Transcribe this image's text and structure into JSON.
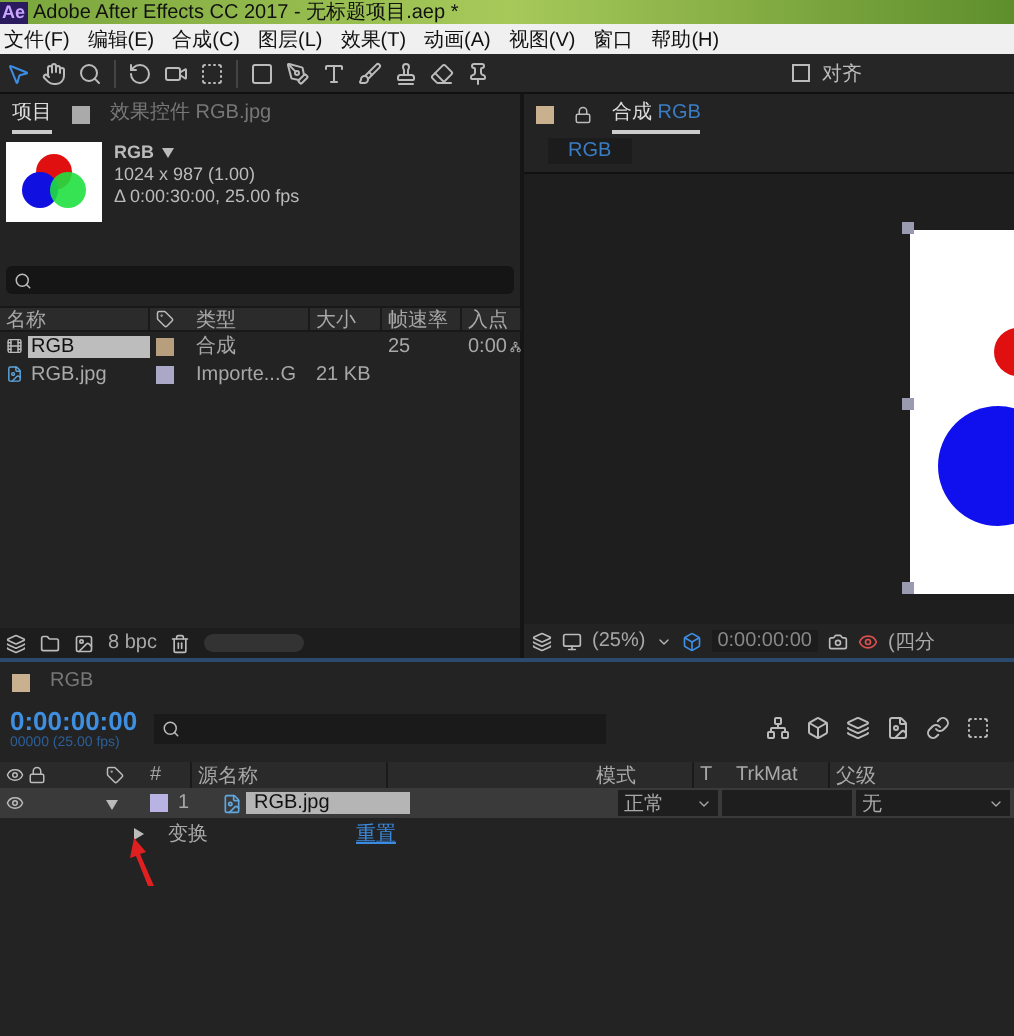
{
  "window": {
    "logo": "Ae",
    "title": "Adobe After Effects CC 2017 - 无标题项目.aep *"
  },
  "menu": [
    "文件(F)",
    "编辑(E)",
    "合成(C)",
    "图层(L)",
    "效果(T)",
    "动画(A)",
    "视图(V)",
    "窗口",
    "帮助(H)"
  ],
  "toolbar": {
    "snap_label": "对齐",
    "snap_checked": false
  },
  "project_panel": {
    "tabs": [
      {
        "label": "项目",
        "selected": true
      },
      {
        "label": "效果控件 RGB.jpg",
        "selected": false
      }
    ],
    "preview": {
      "name": "RGB",
      "size": "1024 x 987 (1.00)",
      "duration": "Δ 0:00:30:00, 25.00 fps"
    },
    "columns": [
      "名称",
      "类型",
      "大小",
      "帧速率",
      "入点"
    ],
    "rows": [
      {
        "kind": "comp",
        "name": "RGB",
        "type": "合成",
        "fps": "25",
        "in": "0:00",
        "selected": true,
        "color": "#b79e7c"
      },
      {
        "kind": "footage",
        "name": "RGB.jpg",
        "type": "Importe...G",
        "size": "21 KB",
        "selected": false,
        "color": "#a9a9c7"
      }
    ],
    "bpc": "8 bpc"
  },
  "comp_panel": {
    "tab": "合成",
    "comp_name": "RGB",
    "flow_tab": "RGB",
    "zoom": "(25%)",
    "timecode": "0:00:00:00",
    "view": "(四分"
  },
  "timeline": {
    "tab": "RGB",
    "timecode": "0:00:00:00",
    "fps": "00000 (25.00 fps)",
    "columns": {
      "number": "#",
      "source": "源名称",
      "mode": "模式",
      "trkmat_t": "T",
      "trkmat": "TrkMat",
      "parent": "父级"
    },
    "layers": [
      {
        "number": "1",
        "name": "RGB.jpg",
        "expanded": true,
        "selected": true,
        "color": "#b9b3e3",
        "mode": "正常",
        "parent": "无",
        "children": [
          {
            "name": "变换",
            "expanded": false,
            "action": "重置"
          }
        ]
      }
    ]
  }
}
